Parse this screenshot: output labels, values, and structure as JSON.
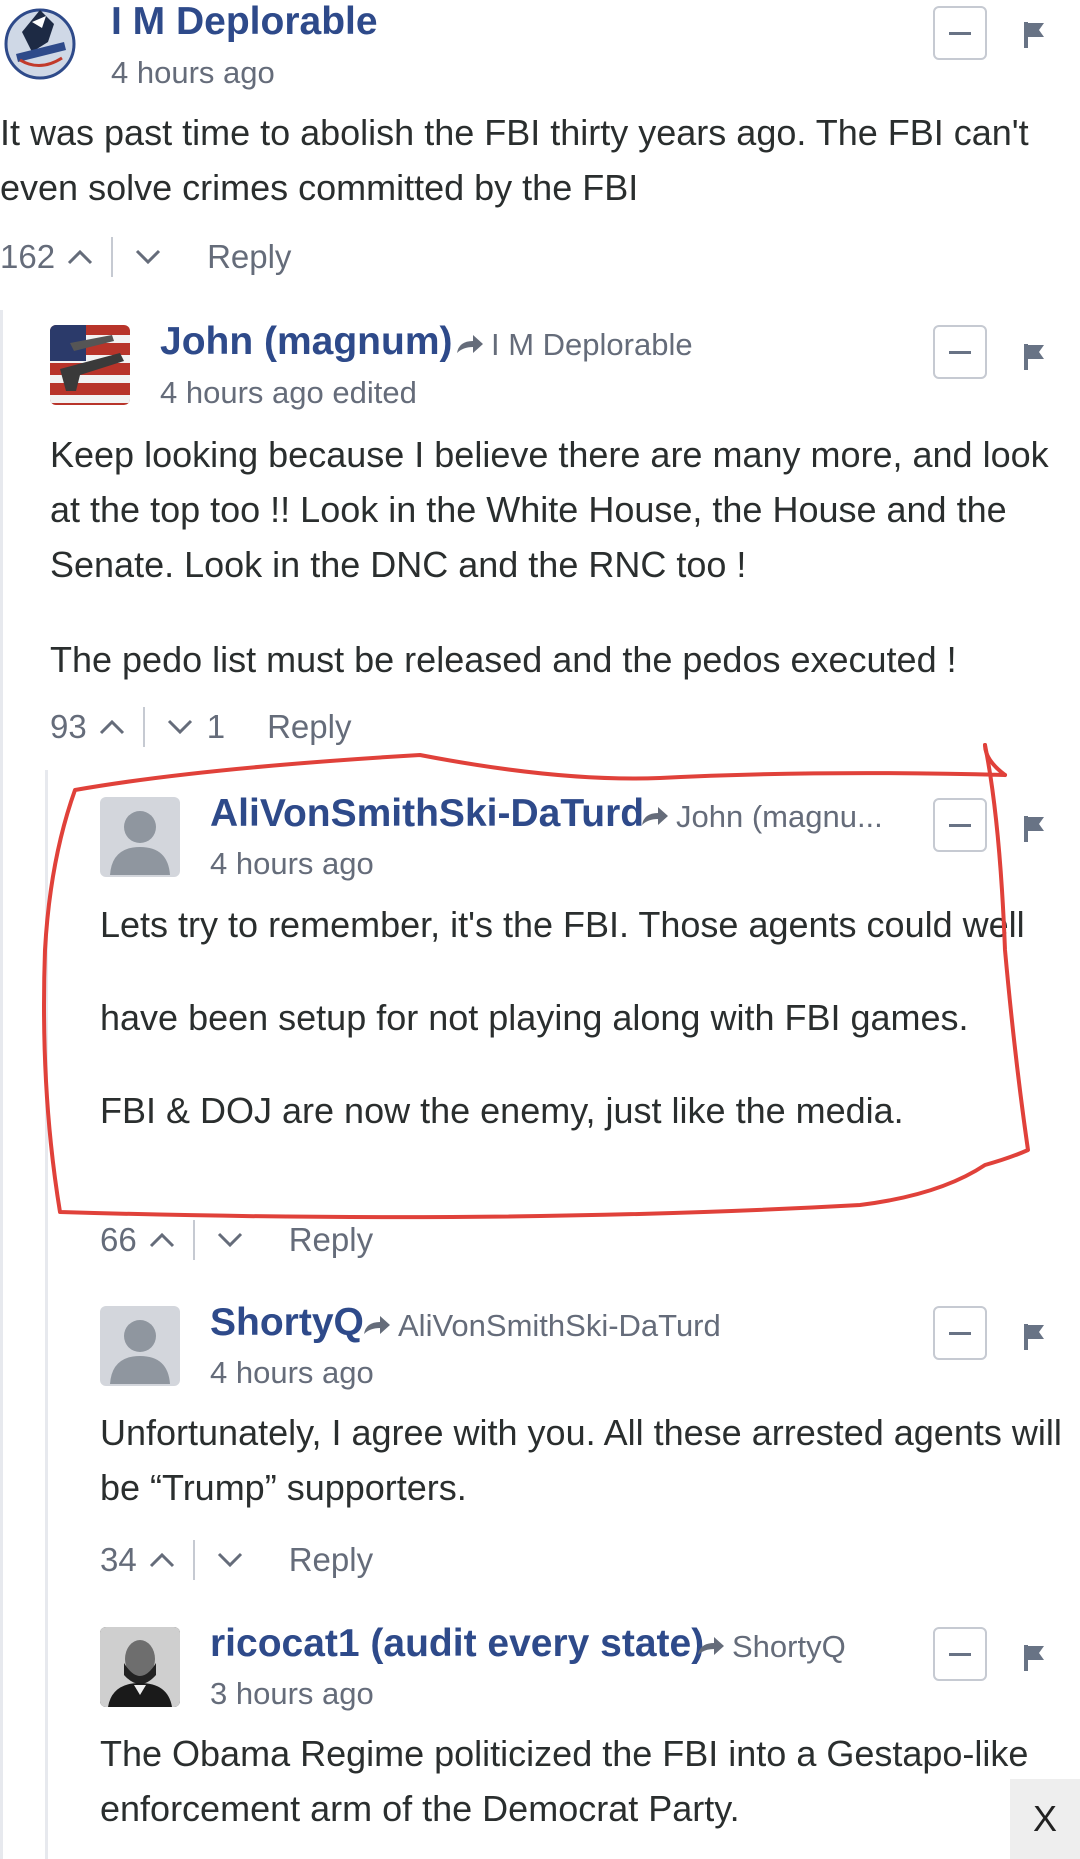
{
  "comments": [
    {
      "author": "I M Deplorable",
      "reply_to": "",
      "time": "4 hours ago",
      "paragraphs": [
        "It was past time to abolish the FBI thirty years ago. The FBI can't even solve crimes committed by the FBI"
      ],
      "upvotes": "162",
      "downvotes": "",
      "reply_label": "Reply"
    },
    {
      "author": "John (magnum)",
      "reply_to": "I M Deplorable",
      "time": "4 hours ago edited",
      "paragraphs": [
        "Keep looking because I believe there are many more, and look at the top too !! Look in the White House, the House and the Senate. Look in the DNC and the RNC too !",
        "The pedo list must be released and the pedos executed !"
      ],
      "upvotes": "93",
      "downvotes": "1",
      "reply_label": "Reply"
    },
    {
      "author": "AliVonSmithSki-DaTurd",
      "reply_to": "John (magnu...",
      "time": "4 hours ago",
      "paragraphs": [
        "Lets try to remember, it's the FBI. Those agents could well",
        "have been setup for not playing along with FBI games.",
        "FBI & DOJ are now the enemy, just like the media."
      ],
      "upvotes": "66",
      "downvotes": "",
      "reply_label": "Reply"
    },
    {
      "author": "ShortyQ",
      "reply_to": "AliVonSmithSki-DaTurd",
      "time": "4 hours ago",
      "paragraphs": [
        "Unfortunately, I agree with you. All these arrested agents will be “Trump” supporters."
      ],
      "upvotes": "34",
      "downvotes": "",
      "reply_label": "Reply"
    },
    {
      "author": "ricocat1 (audit every state)",
      "reply_to": "ShortyQ",
      "time": "3 hours ago",
      "paragraphs": [
        "The Obama Regime politicized the FBI into a Gestapo-like enforcement arm of the Democrat Party."
      ],
      "upvotes": "",
      "downvotes": "",
      "reply_label": ""
    }
  ],
  "close_label": "X",
  "colors": {
    "author": "#2e4a8a",
    "meta": "#656c7a",
    "highlight": "#e0413a"
  }
}
